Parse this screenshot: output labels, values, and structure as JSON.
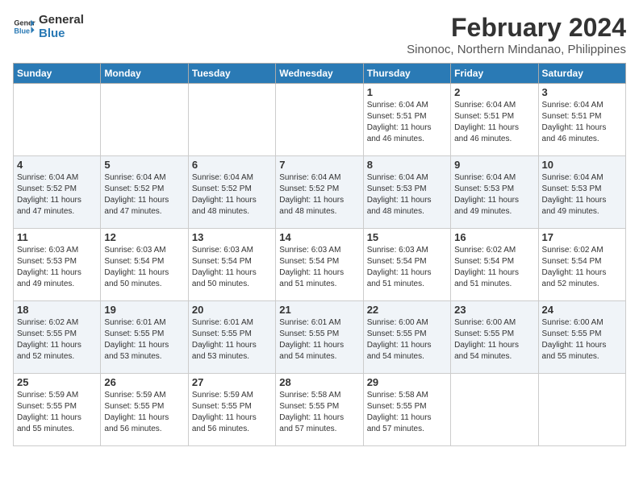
{
  "logo": {
    "line1": "General",
    "line2": "Blue"
  },
  "title": "February 2024",
  "subtitle": "Sinonoc, Northern Mindanao, Philippines",
  "days_of_week": [
    "Sunday",
    "Monday",
    "Tuesday",
    "Wednesday",
    "Thursday",
    "Friday",
    "Saturday"
  ],
  "weeks": [
    [
      {
        "day": "",
        "info": ""
      },
      {
        "day": "",
        "info": ""
      },
      {
        "day": "",
        "info": ""
      },
      {
        "day": "",
        "info": ""
      },
      {
        "day": "1",
        "info": "Sunrise: 6:04 AM\nSunset: 5:51 PM\nDaylight: 11 hours\nand 46 minutes."
      },
      {
        "day": "2",
        "info": "Sunrise: 6:04 AM\nSunset: 5:51 PM\nDaylight: 11 hours\nand 46 minutes."
      },
      {
        "day": "3",
        "info": "Sunrise: 6:04 AM\nSunset: 5:51 PM\nDaylight: 11 hours\nand 46 minutes."
      }
    ],
    [
      {
        "day": "4",
        "info": "Sunrise: 6:04 AM\nSunset: 5:52 PM\nDaylight: 11 hours\nand 47 minutes."
      },
      {
        "day": "5",
        "info": "Sunrise: 6:04 AM\nSunset: 5:52 PM\nDaylight: 11 hours\nand 47 minutes."
      },
      {
        "day": "6",
        "info": "Sunrise: 6:04 AM\nSunset: 5:52 PM\nDaylight: 11 hours\nand 48 minutes."
      },
      {
        "day": "7",
        "info": "Sunrise: 6:04 AM\nSunset: 5:52 PM\nDaylight: 11 hours\nand 48 minutes."
      },
      {
        "day": "8",
        "info": "Sunrise: 6:04 AM\nSunset: 5:53 PM\nDaylight: 11 hours\nand 48 minutes."
      },
      {
        "day": "9",
        "info": "Sunrise: 6:04 AM\nSunset: 5:53 PM\nDaylight: 11 hours\nand 49 minutes."
      },
      {
        "day": "10",
        "info": "Sunrise: 6:04 AM\nSunset: 5:53 PM\nDaylight: 11 hours\nand 49 minutes."
      }
    ],
    [
      {
        "day": "11",
        "info": "Sunrise: 6:03 AM\nSunset: 5:53 PM\nDaylight: 11 hours\nand 49 minutes."
      },
      {
        "day": "12",
        "info": "Sunrise: 6:03 AM\nSunset: 5:54 PM\nDaylight: 11 hours\nand 50 minutes."
      },
      {
        "day": "13",
        "info": "Sunrise: 6:03 AM\nSunset: 5:54 PM\nDaylight: 11 hours\nand 50 minutes."
      },
      {
        "day": "14",
        "info": "Sunrise: 6:03 AM\nSunset: 5:54 PM\nDaylight: 11 hours\nand 51 minutes."
      },
      {
        "day": "15",
        "info": "Sunrise: 6:03 AM\nSunset: 5:54 PM\nDaylight: 11 hours\nand 51 minutes."
      },
      {
        "day": "16",
        "info": "Sunrise: 6:02 AM\nSunset: 5:54 PM\nDaylight: 11 hours\nand 51 minutes."
      },
      {
        "day": "17",
        "info": "Sunrise: 6:02 AM\nSunset: 5:54 PM\nDaylight: 11 hours\nand 52 minutes."
      }
    ],
    [
      {
        "day": "18",
        "info": "Sunrise: 6:02 AM\nSunset: 5:55 PM\nDaylight: 11 hours\nand 52 minutes."
      },
      {
        "day": "19",
        "info": "Sunrise: 6:01 AM\nSunset: 5:55 PM\nDaylight: 11 hours\nand 53 minutes."
      },
      {
        "day": "20",
        "info": "Sunrise: 6:01 AM\nSunset: 5:55 PM\nDaylight: 11 hours\nand 53 minutes."
      },
      {
        "day": "21",
        "info": "Sunrise: 6:01 AM\nSunset: 5:55 PM\nDaylight: 11 hours\nand 54 minutes."
      },
      {
        "day": "22",
        "info": "Sunrise: 6:00 AM\nSunset: 5:55 PM\nDaylight: 11 hours\nand 54 minutes."
      },
      {
        "day": "23",
        "info": "Sunrise: 6:00 AM\nSunset: 5:55 PM\nDaylight: 11 hours\nand 54 minutes."
      },
      {
        "day": "24",
        "info": "Sunrise: 6:00 AM\nSunset: 5:55 PM\nDaylight: 11 hours\nand 55 minutes."
      }
    ],
    [
      {
        "day": "25",
        "info": "Sunrise: 5:59 AM\nSunset: 5:55 PM\nDaylight: 11 hours\nand 55 minutes."
      },
      {
        "day": "26",
        "info": "Sunrise: 5:59 AM\nSunset: 5:55 PM\nDaylight: 11 hours\nand 56 minutes."
      },
      {
        "day": "27",
        "info": "Sunrise: 5:59 AM\nSunset: 5:55 PM\nDaylight: 11 hours\nand 56 minutes."
      },
      {
        "day": "28",
        "info": "Sunrise: 5:58 AM\nSunset: 5:55 PM\nDaylight: 11 hours\nand 57 minutes."
      },
      {
        "day": "29",
        "info": "Sunrise: 5:58 AM\nSunset: 5:55 PM\nDaylight: 11 hours\nand 57 minutes."
      },
      {
        "day": "",
        "info": ""
      },
      {
        "day": "",
        "info": ""
      }
    ]
  ]
}
